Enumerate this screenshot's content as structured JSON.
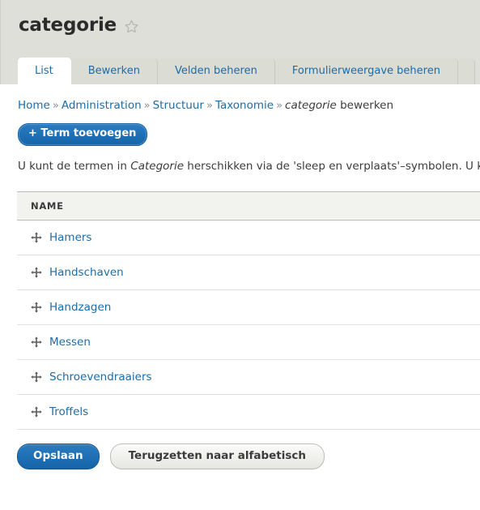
{
  "header": {
    "title": "categorie",
    "star_icon": "star-outline-icon"
  },
  "tabs": [
    {
      "label": "List",
      "active": true
    },
    {
      "label": "Bewerken",
      "active": false
    },
    {
      "label": "Velden beheren",
      "active": false
    },
    {
      "label": "Formulierweergave beheren",
      "active": false
    },
    {
      "label": "",
      "active": false
    }
  ],
  "breadcrumb": {
    "items": [
      {
        "label": "Home",
        "link": true
      },
      {
        "label": "Administration",
        "link": true
      },
      {
        "label": "Structuur",
        "link": true
      },
      {
        "label": "Taxonomie",
        "link": true
      }
    ],
    "separator": "»",
    "current_italic": "categorie",
    "current_rest": " bewerken"
  },
  "actions": {
    "add_term_label": "+ Term toevoegen"
  },
  "description": {
    "before_em": "U kunt de termen in ",
    "em": "Categorie",
    "after_em": " herschikken via de 'sleep en verplaats'–symbolen. U kunt te"
  },
  "table": {
    "columns": [
      "NAME"
    ],
    "rows": [
      {
        "drag_icon": "move-cross-icon",
        "name": "Hamers"
      },
      {
        "drag_icon": "move-cross-icon",
        "name": "Handschaven"
      },
      {
        "drag_icon": "move-cross-icon",
        "name": "Handzagen"
      },
      {
        "drag_icon": "move-cross-icon",
        "name": "Messen"
      },
      {
        "drag_icon": "move-cross-icon",
        "name": "Schroevendraaiers"
      },
      {
        "drag_icon": "move-cross-icon",
        "name": "Troffels"
      }
    ]
  },
  "footer": {
    "save_label": "Opslaan",
    "reset_label": "Terugzetten naar alfabetisch"
  },
  "colors": {
    "link": "#1d6ca8",
    "primary_button": "#1665ab",
    "header_bg": "#dedfd8",
    "table_header_bg": "#f2f2ee",
    "text": "#3b3b3b"
  }
}
